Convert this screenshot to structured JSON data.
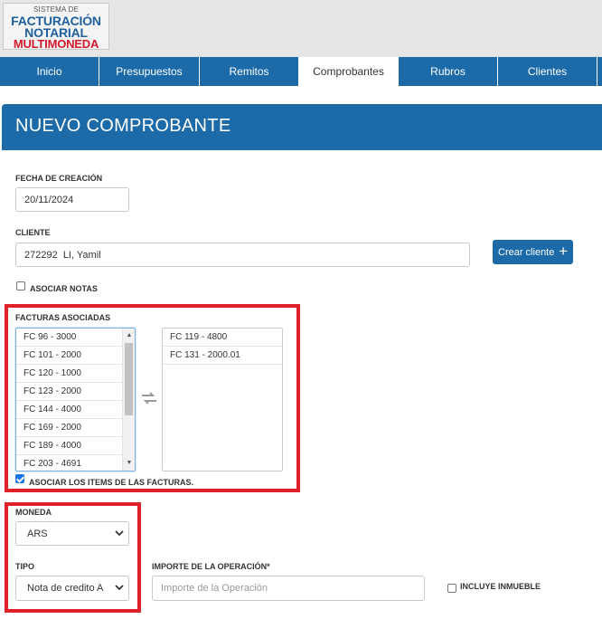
{
  "logo": {
    "line1": "SISTEMA DE",
    "line2": "FACTURACIÓN",
    "line3": "NOTARIAL",
    "line4": "MULTIMONEDA"
  },
  "nav": {
    "tabs": [
      {
        "label": "Inicio",
        "active": false
      },
      {
        "label": "Presupuestos",
        "active": false
      },
      {
        "label": "Remitos",
        "active": false
      },
      {
        "label": "Comprobantes",
        "active": true
      },
      {
        "label": "Rubros",
        "active": false
      },
      {
        "label": "Clientes",
        "active": false
      }
    ]
  },
  "panel": {
    "title": "NUEVO COMPROBANTE"
  },
  "form": {
    "fecha_label": "FECHA DE CREACIÓN",
    "fecha_value": "20/11/2024",
    "cliente_label": "CLIENTE",
    "cliente_value": "272292  LI, Yamil",
    "crear_cliente_label": "Crear cliente",
    "asociar_notas_label": "ASOCIAR NOTAS",
    "asociar_notas_checked": false,
    "facturas_label": "FACTURAS ASOCIADAS",
    "available_facturas": [
      "FC 96 - 3000",
      "FC 101 - 2000",
      "FC 120 - 1000",
      "FC 123 - 2000",
      "FC 144 - 4000",
      "FC 169 - 2000",
      "FC 189 - 4000",
      "FC 203 - 4691"
    ],
    "selected_facturas": [
      "FC 119 - 4800",
      "FC 131 - 2000.01"
    ],
    "asociar_items_label": "ASOCIAR LOS ITEMS DE LAS FACTURAS.",
    "asociar_items_checked": true,
    "moneda_label": "MONEDA",
    "moneda_value": "ARS",
    "tipo_label": "TIPO",
    "tipo_value": "Nota de credito A",
    "importe_label": "IMPORTE DE LA OPERACIÓN*",
    "importe_placeholder": "Importe de la Operación",
    "incluye_inmueble_label": "INCLUYE INMUEBLE",
    "incluye_inmueble_checked": false
  },
  "colors": {
    "brand_blue": "#1d6aa8",
    "highlight_red": "#e0202a",
    "checkbox_blue": "#1a73e8"
  }
}
